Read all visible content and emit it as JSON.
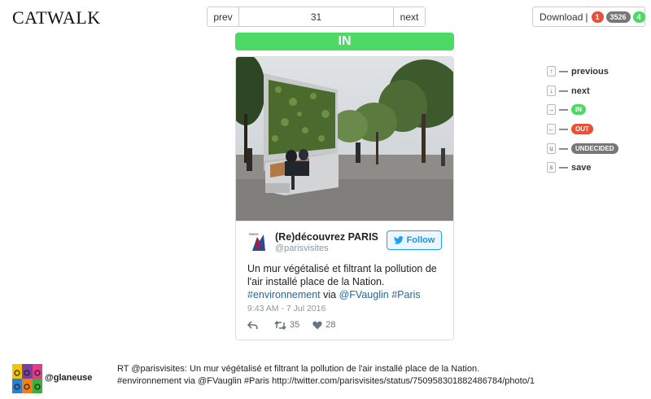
{
  "app": {
    "title": "CATWALK"
  },
  "pager": {
    "prev_label": "prev",
    "next_label": "next",
    "current": "31"
  },
  "download": {
    "label": "Download",
    "separator": "|",
    "counts": {
      "out": "1",
      "undecided": "3526",
      "in": "4"
    }
  },
  "status": {
    "label": "IN",
    "color": "#4cd964"
  },
  "tweet": {
    "name": "(Re)découvrez PARIS",
    "handle": "@parisvisites",
    "follow_label": "Follow",
    "text_line1": "Un mur végétalisé et filtrant la pollution de",
    "text_line2": "l'air installé place de la Nation.",
    "hashtag1": "#environnement",
    "via": "via",
    "mention": "@FVauglin",
    "hashtag2": "#Paris",
    "date": "9:43 AM - 7 Jul 2016",
    "retweets": "35",
    "likes": "28"
  },
  "shortcuts": [
    {
      "key": "↑",
      "label": "previous"
    },
    {
      "key": "↓",
      "label": "next"
    },
    {
      "key": "→",
      "label": "IN"
    },
    {
      "key": "←",
      "label": "OUT"
    },
    {
      "key": "u",
      "label": "UNDECIDED"
    },
    {
      "key": "s",
      "label": "save"
    }
  ],
  "footer": {
    "user": "@glaneuse",
    "text_line1": "RT @parisvisites: Un mur végétalisé et filtrant la pollution de l'air installé place de la Nation.",
    "text_line2": "#environnement via @FVauglin #Paris http://twitter.com/parisvisites/status/750958301882486784/photo/1"
  },
  "colors": {
    "in": "#4cd964",
    "out": "#e8503a",
    "undecided": "#777777",
    "link": "#1b6aa5",
    "twitter_blue": "#1da1f2"
  },
  "icons": [
    "retweet-icon",
    "heart-icon",
    "reply-icon",
    "twitter-bird-icon"
  ]
}
